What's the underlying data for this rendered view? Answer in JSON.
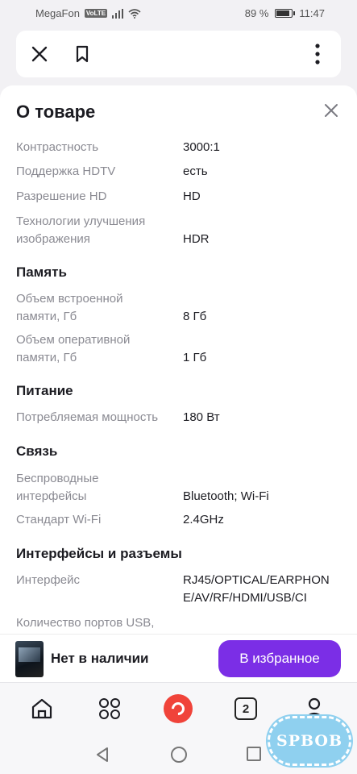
{
  "status_bar": {
    "carrier": "MegaFon",
    "volte": "VoLTE",
    "battery": "89 %",
    "battery_level": 0.89,
    "time": "11:47"
  },
  "top_bar": {
    "icons": [
      "close-icon",
      "bookmark-icon",
      "more-vertical-icon"
    ]
  },
  "sheet": {
    "title": "О товаре",
    "rows_top": [
      {
        "key": "Контрастность",
        "value": "3000:1"
      },
      {
        "key": "Поддержка HDTV",
        "value": "есть"
      },
      {
        "key": "Разрешение HD",
        "value": "HD"
      },
      {
        "key": "Технологии улучшения\nизображения",
        "value": "HDR"
      }
    ],
    "sections": {
      "memory": "Память",
      "power": "Питание",
      "connectivity": "Связь",
      "interfaces": "Интерфейсы и разъемы"
    },
    "memory_rows": [
      {
        "key": "Объем встроенной\nпамяти, Гб",
        "value": "8 Гб"
      },
      {
        "key": "Объем оперативной\nпамяти, Гб",
        "value": "1 Гб"
      }
    ],
    "power_rows": [
      {
        "key": "Потребляемая мощность",
        "value": "180 Вт"
      }
    ],
    "connectivity_rows": [
      {
        "key": "Беспроводные\nинтерфейсы",
        "value": "Bluetooth; Wi-Fi"
      },
      {
        "key": "Стандарт Wi-Fi",
        "value": "2.4GHz"
      }
    ],
    "interface_rows": [
      {
        "key": "Интерфейс",
        "value": "RJ45/OPTICAL/EARPHON\nE/AV/RF/HDMI/USB/CI"
      },
      {
        "key": "Количество портов USB,",
        "value": ""
      }
    ]
  },
  "availability": {
    "text": "Нет в наличии",
    "button": "В избранное",
    "accent": "#7b2ee6"
  },
  "tab_bar": {
    "badge_count": "2",
    "icons": [
      "home-icon",
      "catalog-icon",
      "alice-icon",
      "cart-icon",
      "profile-icon"
    ]
  },
  "watermark": "SPBOB"
}
